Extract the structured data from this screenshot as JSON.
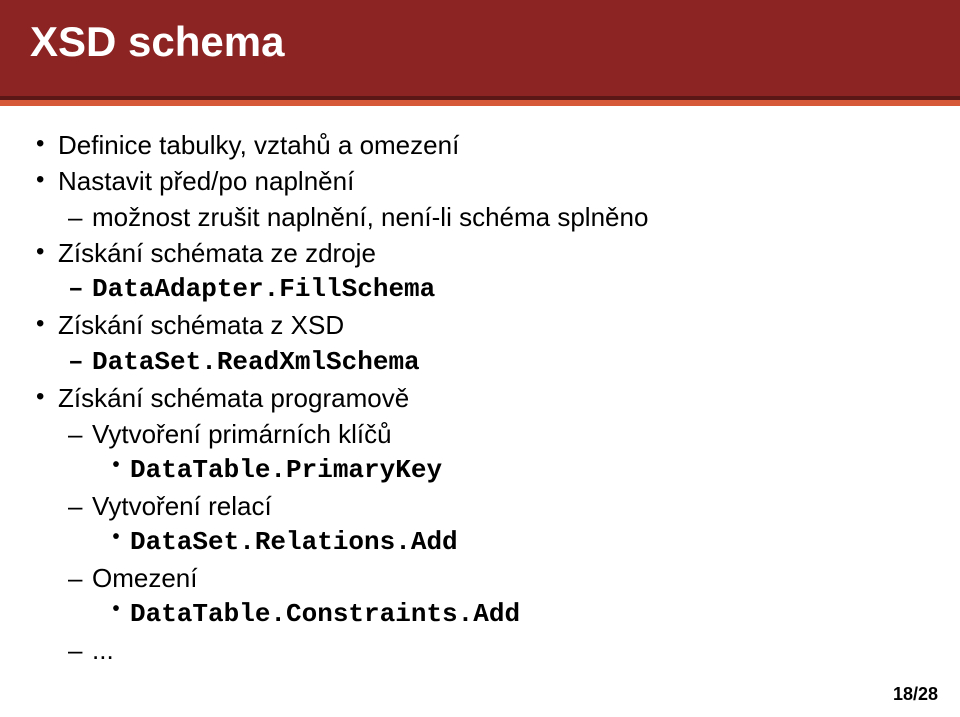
{
  "title": "XSD schema",
  "bullets": {
    "b1": "Definice tabulky, vztahů a omezení",
    "b2": "Nastavit před/po naplnění",
    "b2a": "možnost zrušit naplnění, není-li schéma splněno",
    "b3": "Získání schémata ze zdroje",
    "b3a": "DataAdapter.FillSchema",
    "b4": "Získání schémata z XSD",
    "b4a": "DataSet.ReadXmlSchema",
    "b5": "Získání schémata programově",
    "b5a": "Vytvoření primárních klíčů",
    "b5a1": "DataTable.PrimaryKey",
    "b5b": "Vytvoření relací",
    "b5b1": "DataSet.Relations.Add",
    "b5c": "Omezení",
    "b5c1": "DataTable.Constraints.Add",
    "b5d": "..."
  },
  "pager": "18/28"
}
